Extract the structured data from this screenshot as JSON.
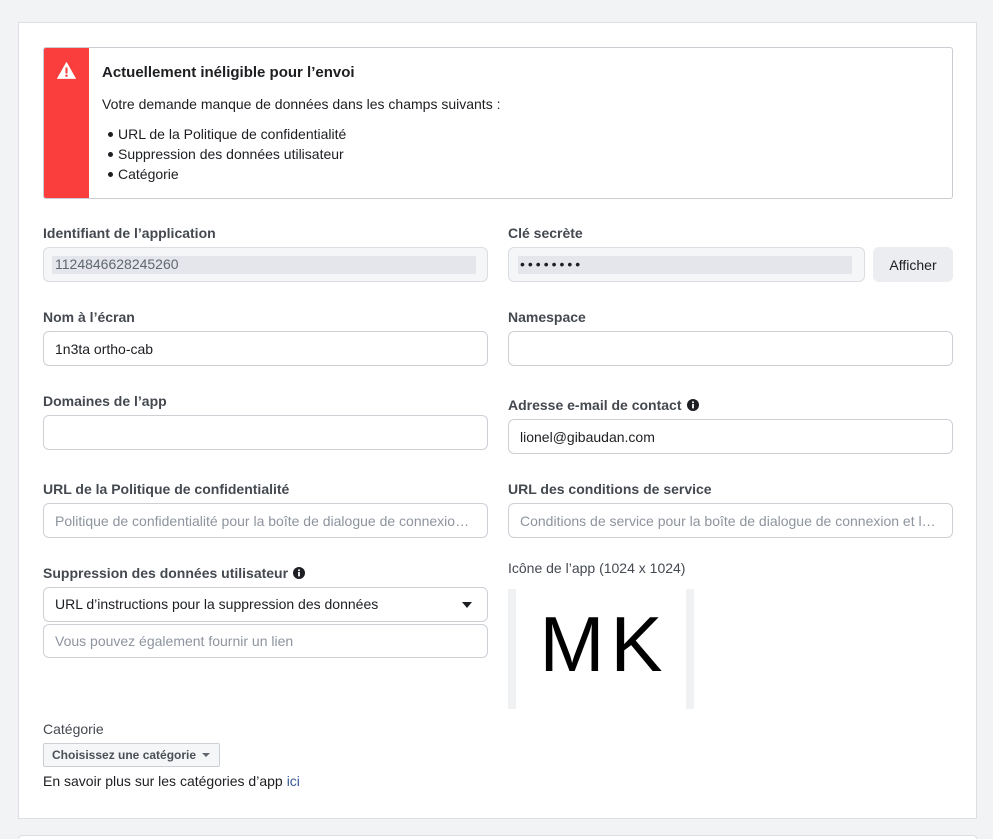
{
  "colors": {
    "alert_accent": "#fa3e3e",
    "link": "#385898"
  },
  "alert": {
    "icon": "warning-icon",
    "title": "Actuellement inéligible pour l’envoi",
    "message": "Votre demande manque de données dans les champs suivants :",
    "missing_fields": [
      "URL de la Politique de confidentialité",
      "Suppression des données utilisateur",
      "Catégorie"
    ]
  },
  "app_id": {
    "label": "Identifiant de l’application",
    "value": "1124846628245260"
  },
  "app_secret": {
    "label": "Clé secrète",
    "value": "••••••••",
    "show_label": "Afficher"
  },
  "display_name": {
    "label": "Nom à l’écran",
    "value": "1n3ta ortho-cab"
  },
  "namespace": {
    "label": "Namespace"
  },
  "app_domains": {
    "label": "Domaines de l’app"
  },
  "contact_email": {
    "label": "Adresse e-mail de contact",
    "icon": "info-icon",
    "value": "lionel@gibaudan.com"
  },
  "privacy_policy_url": {
    "label": "URL de la Politique de confidentialité",
    "placeholder": "Politique de confidentialité pour la boîte de dialogue de connexion …"
  },
  "terms_url": {
    "label": "URL des conditions de service",
    "placeholder": "Conditions de service pour la boîte de dialogue de connexion et le…"
  },
  "data_deletion": {
    "label": "Suppression des données utilisateur",
    "icon": "info-icon",
    "selected_option": "URL d’instructions pour la suppression des données",
    "link_placeholder": "Vous pouvez également fournir un lien"
  },
  "app_icon": {
    "label": "Icône de l’app (1024 x 1024)",
    "image_text": "MK"
  },
  "category": {
    "label": "Catégorie",
    "select_label": "Choisissez une catégorie",
    "help_text": "En savoir plus sur les catégories d’app",
    "help_link": "ici"
  }
}
